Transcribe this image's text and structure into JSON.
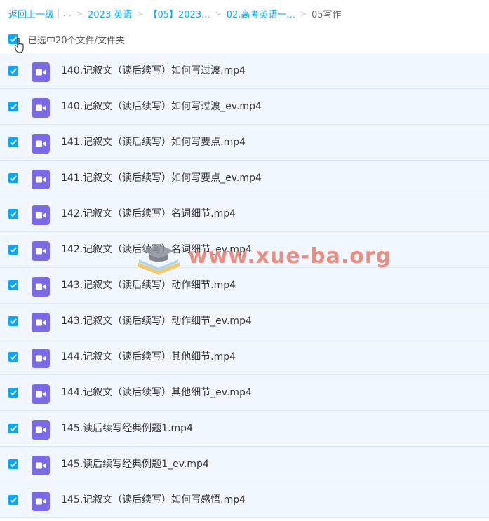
{
  "breadcrumb": {
    "back": "返回上一级",
    "ellipsis": "...",
    "items": [
      "2023 英语",
      "【05】2023...",
      "02.高考英语一...",
      "05写作"
    ]
  },
  "selection": {
    "label": "已选中20个文件/文件夹"
  },
  "files": [
    "140.记叙文（读后续写）如何写过渡.mp4",
    "140.记叙文（读后续写）如何写过渡_ev.mp4",
    "141.记叙文（读后续写）如何写要点.mp4",
    "141.记叙文（读后续写）如何写要点_ev.mp4",
    "142.记叙文（读后续写）名词细节.mp4",
    "142.记叙文（读后续写）名词细节_ev.mp4",
    "143.记叙文（读后续写）动作细节.mp4",
    "143.记叙文（读后续写）动作细节_ev.mp4",
    "144.记叙文（读后续写）其他细节.mp4",
    "144.记叙文（读后续写）其他细节_ev.mp4",
    "145.读后续写经典例题1.mp4",
    "145.读后续写经典例题1_ev.mp4",
    "145.记叙文（读后续写）如何写感悟.mp4"
  ],
  "watermark": {
    "text": "www.xue-ba.org"
  },
  "colors": {
    "accent": "#06a7ff",
    "row_bg": "#f0f7ff",
    "video_icon": "#7b6ae6"
  }
}
